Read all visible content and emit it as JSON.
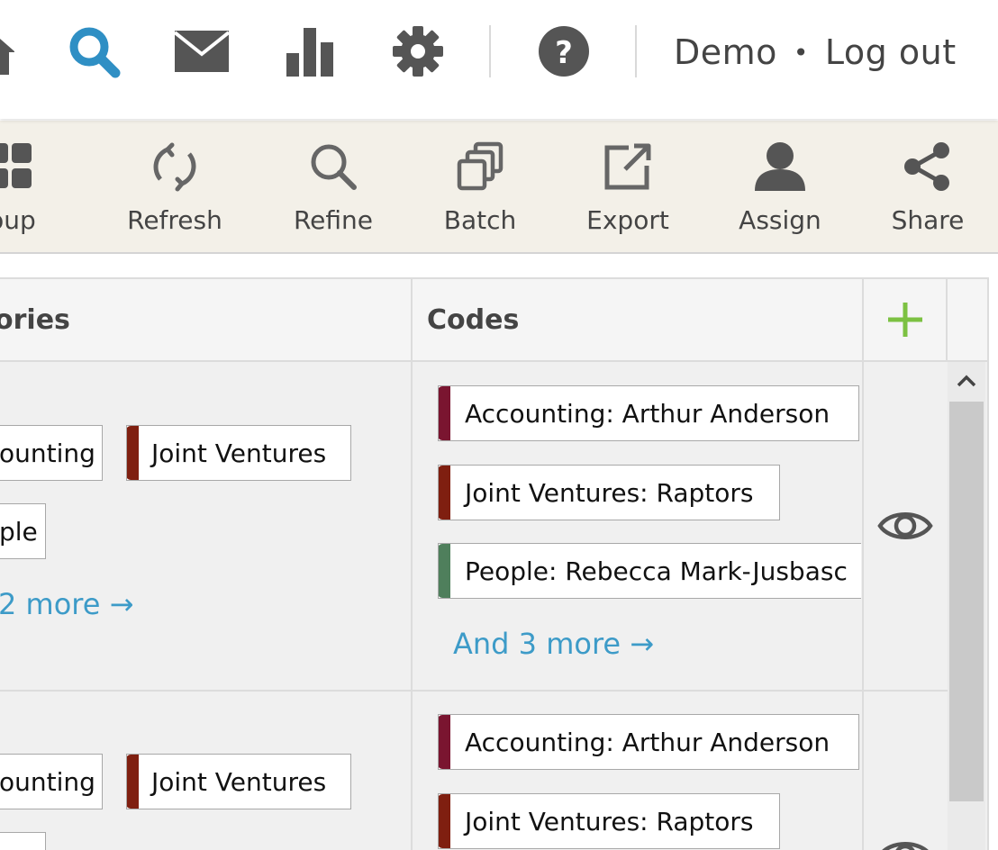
{
  "nav": {
    "icons": [
      "home-icon",
      "search-icon",
      "mail-icon",
      "bar-chart-icon",
      "gear-icon",
      "help-icon"
    ],
    "accent": "#2f8fc4",
    "icon_color": "#555555",
    "user": "Demo",
    "separator": "•",
    "logout": "Log out"
  },
  "toolbar": {
    "group": "roup",
    "refresh": "Refresh",
    "refine": "Refine",
    "batch": "Batch",
    "export": "Export",
    "assign": "Assign",
    "share": "Share"
  },
  "table": {
    "headers": {
      "categories": "ories",
      "codes": "Codes",
      "add": "+"
    },
    "rows": [
      {
        "categories": [
          "ounting",
          "Joint Ventures",
          "ple"
        ],
        "categories_more": "2 more →",
        "codes": [
          {
            "label": "Accounting: Arthur Anderson",
            "color": "#7a1530"
          },
          {
            "label": "Joint Ventures: Raptors",
            "color": "#7f1f10"
          },
          {
            "label": "People: Rebecca Mark-Jusbasc",
            "color": "#4f7f5c"
          }
        ],
        "codes_more": "And 3 more →"
      },
      {
        "categories": [
          "ounting",
          "Joint Ventures"
        ],
        "codes": [
          {
            "label": "Accounting: Arthur Anderson",
            "color": "#7a1530"
          },
          {
            "label": "Joint Ventures: Raptors",
            "color": "#7f1f10"
          }
        ]
      }
    ]
  },
  "colors": {
    "accounting": "#7a1530",
    "joint_ventures": "#7f1f10",
    "people": "#4f7f5c",
    "link": "#3d9bc8",
    "add": "#7cc142"
  }
}
